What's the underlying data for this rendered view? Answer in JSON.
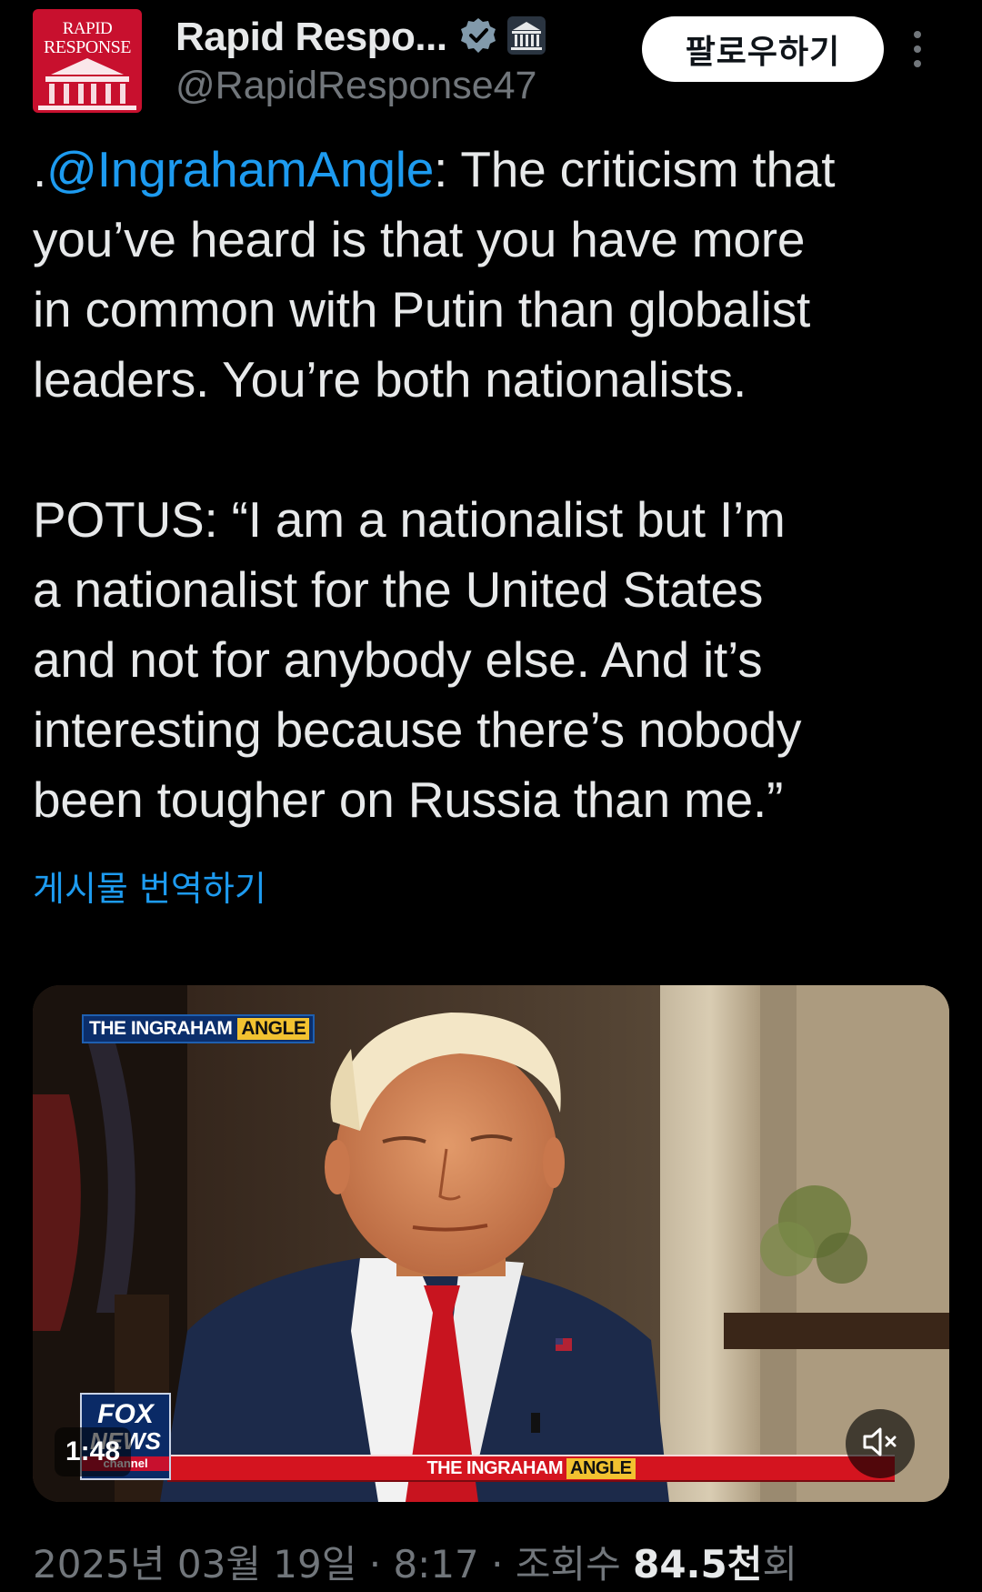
{
  "author": {
    "display_name": "Rapid Respo...",
    "handle": "@RapidResponse47",
    "avatar_text_line1": "RAPID",
    "avatar_text_line2": "RESPONSE",
    "avatar_color": "#c8102e",
    "verified_icon": "verified-badge-icon",
    "affiliation_icon": "white-house-icon"
  },
  "actions": {
    "follow_label": "팔로우하기",
    "more_icon": "more-vertical-icon"
  },
  "tweet": {
    "mention": "@IngrahamAngle",
    "text_prefix": ".",
    "text_after_mention": ": The criticism that\nyou’ve heard is that you have more\nin common with Putin than globalist\nleaders. You’re both nationalists.\n\nPOTUS: “I am a nationalist but I’m\na nationalist for the United States\nand not for anybody else. And it’s\ninteresting because there’s nobody\nbeen tougher on Russia than me.”",
    "translate_label": "게시물 번역하기"
  },
  "video": {
    "duration": "1:48",
    "top_badge_show": "THE INGRAHAM",
    "top_badge_angle": "ANGLE",
    "lower_third_show": "THE INGRAHAM",
    "lower_third_angle": "ANGLE",
    "logo_fox": "FOX",
    "logo_news": "NEWS",
    "logo_channel": "channel",
    "mute_icon": "speaker-muted-icon"
  },
  "meta": {
    "date_time": "2025년 03월 19일 · 8:17 · 조회수 ",
    "views_number": "84.5천",
    "views_suffix": "회"
  },
  "colors": {
    "background": "#000000",
    "text_primary": "#e7e9ea",
    "text_secondary": "#71767b",
    "link": "#1d9bf0",
    "follow_button_bg": "#ffffff"
  }
}
